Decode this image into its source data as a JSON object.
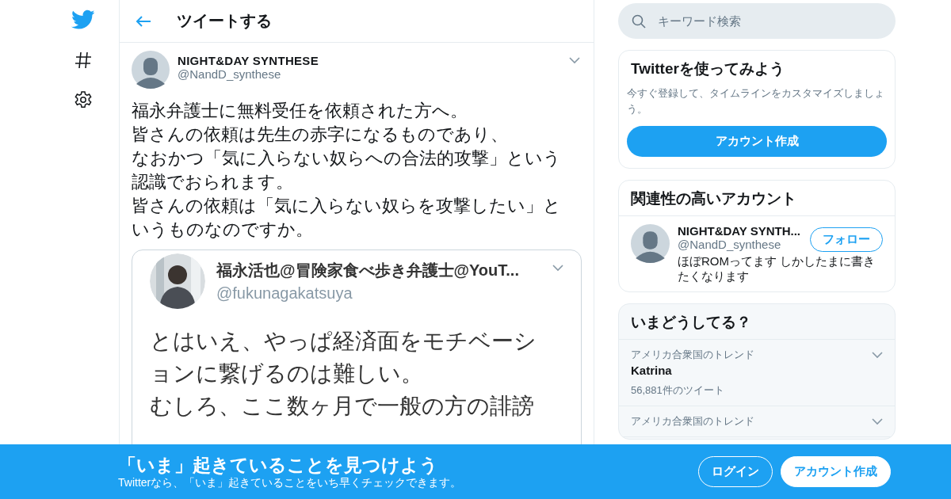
{
  "header": {
    "title": "ツイートする"
  },
  "tweet": {
    "name": "NIGHT&DAY SYNTHESE",
    "handle": "@NandD_synthese",
    "text_lines": [
      "福永弁護士に無料受任を依頼された方へ。",
      "皆さんの依頼は先生の赤字になるものであり、",
      "なおかつ「気に入らない奴らへの合法的攻撃」という認識でおられます。",
      "皆さんの依頼は「気に入らない奴らを攻撃したい」というものなのですか。"
    ],
    "embedded": {
      "name": "福永活也@冒険家食べ歩き弁護士@YouT...",
      "handle": "@fukunagakatsuya",
      "lines": [
        "とはいえ、やっぱ経済面をモチベーシ",
        "ョンに繋げるのは難しい。",
        "むしろ、ここ数ヶ月で一般の方の誹謗"
      ]
    }
  },
  "sidebar": {
    "search": {
      "placeholder": "キーワード検索"
    },
    "signup": {
      "title": "Twitterを使ってみよう",
      "description": "今すぐ登録して、タイムラインをカスタマイズしましょう。",
      "button": "アカウント作成"
    },
    "related": {
      "title": "関連性の高いアカウント",
      "accounts": [
        {
          "name": "NIGHT&DAY SYNTH...",
          "handle": "@NandD_synthese",
          "bio": "ほぼROMってます しかしたまに書きたくなります",
          "follow": "フォロー"
        }
      ]
    },
    "trends": {
      "title": "いまどうしてる？",
      "items": [
        {
          "context": "アメリカ合衆国のトレンド",
          "name": "Katrina",
          "count": "56,881件のツイート"
        },
        {
          "context": "アメリカ合衆国のトレンド"
        }
      ]
    }
  },
  "banner": {
    "title": "「いま」起きていることを見つけよう",
    "subtitle": "Twitterなら、「いま」起きていることをいち早くチェックできます。",
    "buttons": [
      {
        "label": "ログイン",
        "kind": "outline"
      },
      {
        "label": "アカウント作成",
        "kind": "filled"
      }
    ]
  }
}
